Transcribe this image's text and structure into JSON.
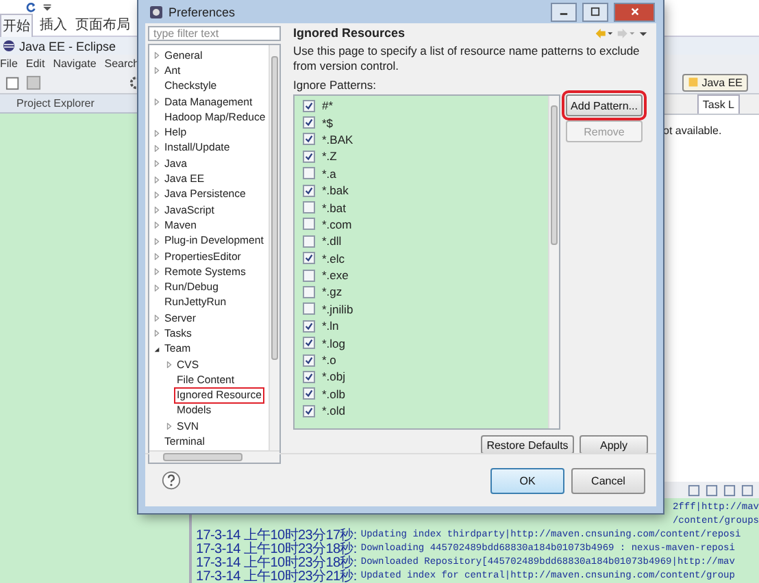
{
  "ribbon": {
    "tabs": [
      {
        "label": "开始",
        "selected": true
      },
      {
        "label": "插入",
        "selected": false
      },
      {
        "label": "页面布局",
        "selected": false
      }
    ]
  },
  "eclipse": {
    "title": "Java EE - Eclipse",
    "menu": [
      "File",
      "Edit",
      "Navigate",
      "Search"
    ],
    "perspective": "Java EE",
    "left_view": "Project Explorer",
    "right_tab": "Task L",
    "message": "ot available.",
    "console_partial": [
      "2fff|http://mav",
      "/content/groups"
    ],
    "console": [
      {
        "time": "17-3-14 上午10时23分17秒:",
        "text": "Updating index thirdparty|http://maven.cnsuning.com/content/reposi"
      },
      {
        "time": "17-3-14 上午10时23分18秒:",
        "text": "Downloading 445702489bdd68830a184b01073b4969 : nexus-maven-reposi"
      },
      {
        "time": "17-3-14 上午10时23分18秒:",
        "text": "Downloaded Repository[445702489bdd68830a184b01073b4969|http://mav"
      },
      {
        "time": "17-3-14 上午10时23分21秒:",
        "text": "Updated index for central|http://maven.cnsuning.com/content/group"
      }
    ]
  },
  "dialog": {
    "title": "Preferences",
    "filter": {
      "placeholder": "type filter text"
    },
    "tree": [
      {
        "label": "General",
        "expandable": true
      },
      {
        "label": "Ant",
        "expandable": true
      },
      {
        "label": "Checkstyle",
        "expandable": false
      },
      {
        "label": "Data Management",
        "expandable": true
      },
      {
        "label": "Hadoop Map/Reduce",
        "expandable": false
      },
      {
        "label": "Help",
        "expandable": true
      },
      {
        "label": "Install/Update",
        "expandable": true
      },
      {
        "label": "Java",
        "expandable": true
      },
      {
        "label": "Java EE",
        "expandable": true
      },
      {
        "label": "Java Persistence",
        "expandable": true
      },
      {
        "label": "JavaScript",
        "expandable": true
      },
      {
        "label": "Maven",
        "expandable": true
      },
      {
        "label": "Plug-in Development",
        "expandable": true
      },
      {
        "label": "PropertiesEditor",
        "expandable": true
      },
      {
        "label": "Remote Systems",
        "expandable": true
      },
      {
        "label": "Run/Debug",
        "expandable": true
      },
      {
        "label": "RunJettyRun",
        "expandable": false
      },
      {
        "label": "Server",
        "expandable": true
      },
      {
        "label": "Tasks",
        "expandable": true
      },
      {
        "label": "Team",
        "expandable": true,
        "expanded": true,
        "children": [
          {
            "label": "CVS",
            "expandable": true
          },
          {
            "label": "File Content",
            "expandable": false
          },
          {
            "label": "Ignored Resource",
            "expandable": false,
            "marked": true
          },
          {
            "label": "Models",
            "expandable": false
          },
          {
            "label": "SVN",
            "expandable": true
          }
        ]
      },
      {
        "label": "Terminal",
        "expandable": false
      }
    ],
    "page_title": "Ignored Resources",
    "description": "Use this page to specify a list of resource name patterns to exclude from version control.",
    "list_label": "Ignore Patterns:",
    "patterns": [
      {
        "label": "#*",
        "checked": true
      },
      {
        "label": "*$",
        "checked": true
      },
      {
        "label": "*.BAK",
        "checked": true
      },
      {
        "label": "*.Z",
        "checked": true
      },
      {
        "label": "*.a",
        "checked": false
      },
      {
        "label": "*.bak",
        "checked": true
      },
      {
        "label": "*.bat",
        "checked": false
      },
      {
        "label": "*.com",
        "checked": false
      },
      {
        "label": "*.dll",
        "checked": false
      },
      {
        "label": "*.elc",
        "checked": true
      },
      {
        "label": "*.exe",
        "checked": false
      },
      {
        "label": "*.gz",
        "checked": false
      },
      {
        "label": "*.jnilib",
        "checked": false
      },
      {
        "label": "*.ln",
        "checked": true
      },
      {
        "label": "*.log",
        "checked": true
      },
      {
        "label": "*.o",
        "checked": true
      },
      {
        "label": "*.obj",
        "checked": true
      },
      {
        "label": "*.olb",
        "checked": true
      },
      {
        "label": "*.old",
        "checked": true
      }
    ],
    "side_buttons": [
      {
        "label": "Add Pattern...",
        "disabled": false,
        "marked": true
      },
      {
        "label": "Remove",
        "disabled": true
      }
    ],
    "page_buttons": [
      "Restore Defaults",
      "Apply"
    ],
    "buttons": [
      {
        "label": "OK",
        "default": true
      },
      {
        "label": "Cancel",
        "default": false
      }
    ]
  }
}
